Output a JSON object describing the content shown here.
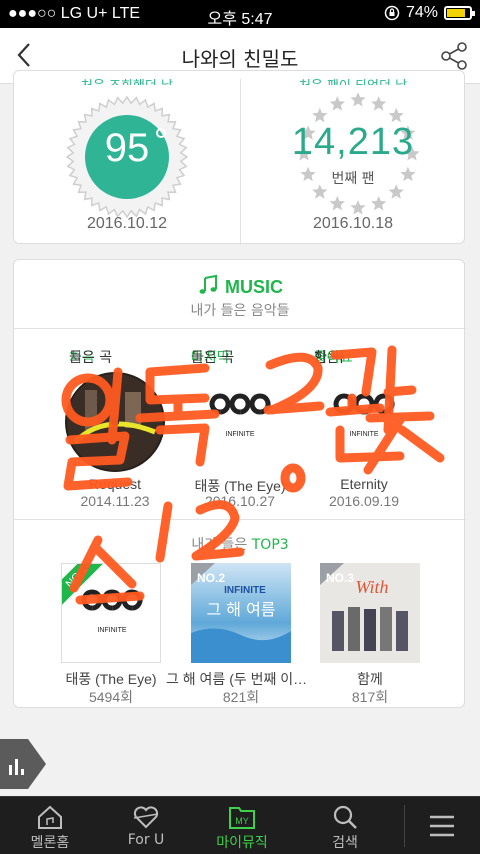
{
  "status": {
    "carrier": "●●●○○ LG U+  LTE",
    "time": "오후 5:47",
    "battery": "74%"
  },
  "header": {
    "title": "나와의 친밀도"
  },
  "stats": {
    "left_peek": "처음 조회했던 날",
    "right_peek": "처음 팬이 되었던 날",
    "intimacy_value": "95",
    "intimacy_date": "2016.10.12",
    "fan_number": "14,213",
    "fan_label": "번째 팬",
    "fan_date": "2016.10.18"
  },
  "music": {
    "title": "MUSIC",
    "subtitle": "내가 들은 음악들",
    "categories": [
      {
        "prefix": "처음",
        "rest": " 들은 곡"
      },
      {
        "prefix": "마지막",
        "rest": " 들은 곡"
      },
      {
        "prefix": "처음 ",
        "highlight": "좋아요",
        "rest": "한 곡"
      }
    ],
    "songs": [
      {
        "title": "Request",
        "date": "2014.11.23"
      },
      {
        "title": "태풍 (The Eye)",
        "date": "2016.10.27"
      },
      {
        "title": "Eternity",
        "date": "2016.09.19"
      }
    ],
    "top3_prefix": "내가 들은 ",
    "top3_highlight": "TOP3",
    "top3": [
      {
        "rank": "NO.1",
        "title": "태풍 (The Eye)",
        "count": "5494회"
      },
      {
        "rank": "NO.2",
        "title": "그 해 여름 (두 번째 이야기)",
        "count": "821회"
      },
      {
        "rank": "NO.3",
        "title": "함께",
        "count": "817회"
      }
    ],
    "album_text": {
      "band": "INFINITE",
      "album2": "그 해 여름",
      "album3": "With"
    }
  },
  "tabbar": {
    "items": [
      {
        "label": "멜론홈",
        "icon": "home-icon"
      },
      {
        "label": "For U",
        "icon": "heart-icon"
      },
      {
        "label": "마이뮤직",
        "icon": "my-music-icon",
        "badge": "MY"
      },
      {
        "label": "검색",
        "icon": "search-icon"
      },
      {
        "label": "",
        "icon": "menu-icon"
      }
    ]
  },
  "overlay": {
    "handwriting_lines": [
      "일톡 2관",
      "1 2 0 ㅅ"
    ]
  },
  "colors": {
    "green": "#1fb64c",
    "teal": "#2aa98c",
    "scribble": "#ff5a1f"
  }
}
